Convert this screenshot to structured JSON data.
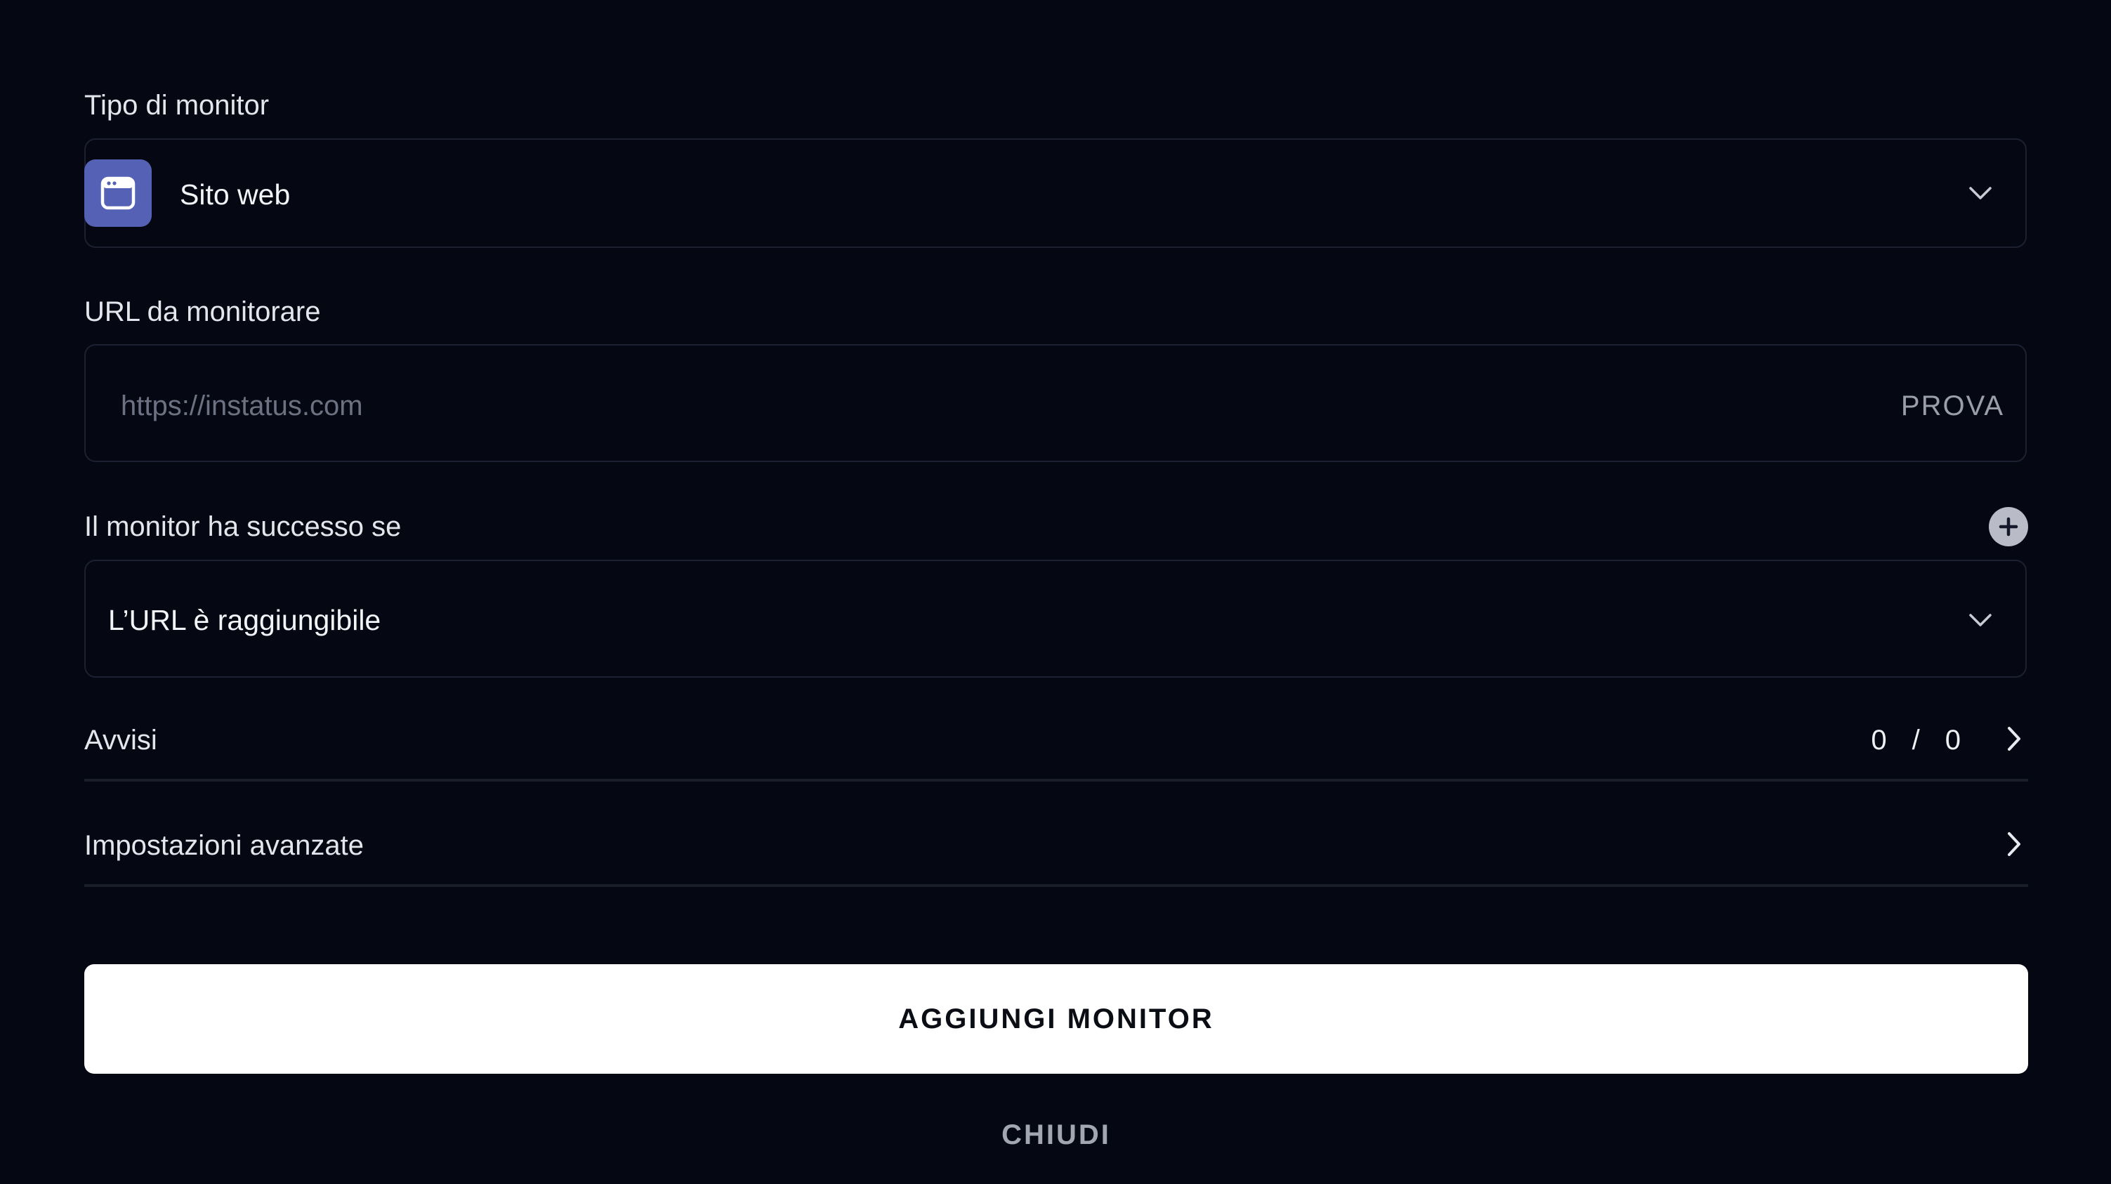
{
  "monitor_type": {
    "label": "Tipo di monitor",
    "selected": "Sito web",
    "icon": "browser-window-icon",
    "icon_color": "#5561b5"
  },
  "url": {
    "label": "URL da monitorare",
    "placeholder": "https://instatus.com",
    "value": "",
    "test_label": "PROVA"
  },
  "success": {
    "label": "Il monitor ha successo se",
    "selected": "L’URL è raggiungibile",
    "add_icon": "plus-icon"
  },
  "alerts": {
    "label": "Avvisi",
    "count_current": "0",
    "separator": "/",
    "count_total": "0"
  },
  "advanced": {
    "label": "Impostazioni avanzate"
  },
  "actions": {
    "add_label": "AGGIUNGI MONITOR",
    "close_label": "CHIUDI"
  },
  "colors": {
    "background": "#050813",
    "primary_button": "#ffffff",
    "border": "#1c2030"
  }
}
